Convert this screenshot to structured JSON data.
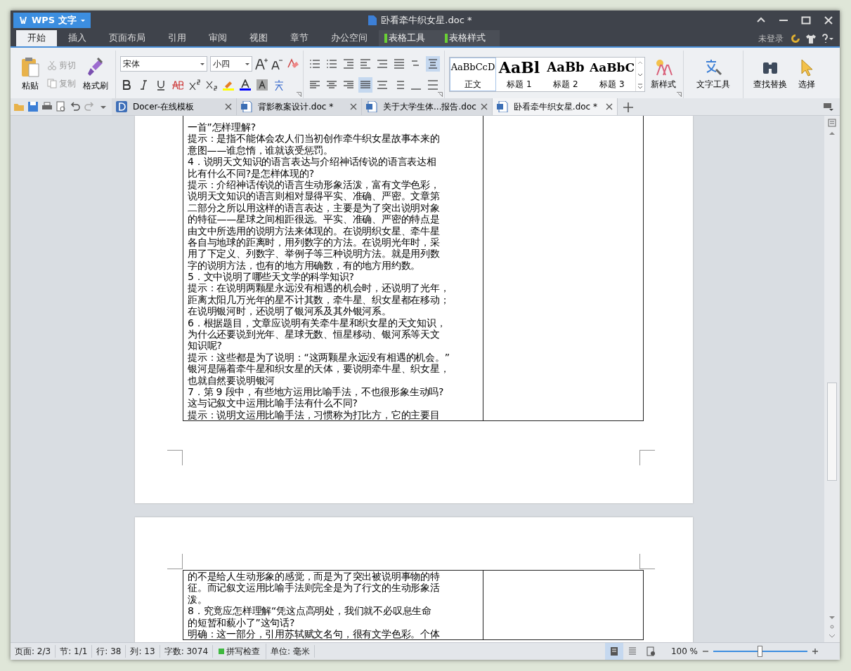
{
  "app_menu": {
    "label": "WPS 文字"
  },
  "window": {
    "title": "卧看牵牛织女星.doc *"
  },
  "ribbon_tabs": [
    {
      "label": "开始",
      "selected": true,
      "kind": "main"
    },
    {
      "label": "插入",
      "selected": false,
      "kind": "main"
    },
    {
      "label": "页面布局",
      "selected": false,
      "kind": "main"
    },
    {
      "label": "引用",
      "selected": false,
      "kind": "main"
    },
    {
      "label": "审阅",
      "selected": false,
      "kind": "main"
    },
    {
      "label": "视图",
      "selected": false,
      "kind": "main"
    },
    {
      "label": "章节",
      "selected": false,
      "kind": "main"
    },
    {
      "label": "办公空间",
      "selected": false,
      "kind": "main"
    },
    {
      "label": "表格工具",
      "selected": false,
      "kind": "context"
    },
    {
      "label": "表格样式",
      "selected": false,
      "kind": "context"
    }
  ],
  "account": {
    "label": "未登录"
  },
  "clipboard": {
    "paste": "粘贴",
    "cut": "剪切",
    "copy": "复制",
    "painter": "格式刷"
  },
  "font": {
    "name": "宋体",
    "size": "小四"
  },
  "styles": [
    {
      "sample": "AaBbCcD",
      "label": "正文",
      "selected": true
    },
    {
      "sample": "AaBl",
      "label": "标题 1",
      "selected": false
    },
    {
      "sample": "AaBb",
      "label": "标题 2",
      "selected": false
    },
    {
      "sample": "AaBbC",
      "label": "标题 3",
      "selected": false
    }
  ],
  "ribbon_buttons": [
    "新样式",
    "文字工具",
    "查找替换",
    "选择"
  ],
  "doc_tabs": [
    {
      "label": "Docer-在线模板",
      "selected": false,
      "kind": "docer"
    },
    {
      "label": "背影教案设计.doc *",
      "selected": false,
      "kind": "doc"
    },
    {
      "label": "关于大学生体...报告.doc",
      "selected": false,
      "kind": "doc"
    },
    {
      "label": "卧看牵牛织女星.doc *",
      "selected": true,
      "kind": "doc"
    }
  ],
  "pages": [
    {
      "lines": [
        "一首”怎样理解?",
        "提示：是指不能体会农人们当初创作牵牛织女星故事本来的",
        "意图——谁怠惰，谁就该受惩罚。",
        "4．说明天文知识的语言表达与介绍神话传说的语言表达相",
        "比有什么不同?是怎样体现的?",
        "提示：介绍神话传说的语言生动形象活泼，富有文学色彩，",
        "说明天文知识的语言则相对显得平实、准确、严密。文章第",
        "二部分之所以用这样的语言表达，主要是为了突出说明对象",
        "的特征——星球之间相距很远。平实、准确、严密的特点是",
        "由文中所选用的说明方法来体现的。在说明织女星、牵牛星",
        "各自与地球的距离时，用列数字的方法。在说明光年时，采",
        "用了下定义、列数字、举例子等三种说明方法。就是用列数",
        "字的说明方法，也有的地方用确数，有的地方用约数。",
        "5．文中说明了哪些天文学的科学知识?",
        "提示：在说明两颗星永远没有相遇的机会时，还说明了光年，",
        "距离太阳几万光年的星不计其数，牵牛星、织女星都在移动；",
        "在说明银河时，还说明了银河系及其外银河系。",
        "6．根据题目，文章应说明有关牵牛星和织女星的天文知识，",
        "为什么还要说到光年、星球无数、恒星移动、银河系等天文",
        "知识呢?",
        "提示：这些都是为了说明：“这两颗星永远没有相遇的机会。”",
        "银河是隔着牵牛星和织女星的天体，要说明牵牛星、织女星，",
        "也就自然要说明银河",
        "7．第 9 段中，有些地方运用比喻手法，不也很形象生动吗?",
        "这与记叙文中运用比喻手法有什么不同?",
        "提示：说明文运用比喻手法，习惯称为打比方，它的主要目"
      ]
    },
    {
      "lines": [
        "的不是给人生动形象的感觉，而是为了突出被说明事物的特",
        "征。而记叙文运用比喻手法则完全是为了行文的生动形象活",
        "泼。",
        "8．究竟应怎样理解“凭这点高明处，我们就不必叹息生命",
        "的短暂和藐小了”这句话?",
        "明确：这一部分，引用苏轼赋文名句，很有文学色彩。个体"
      ]
    }
  ],
  "status_bar": [
    {
      "label": "页面: 2/3",
      "kind": "text"
    },
    {
      "label": "节: 1/1",
      "kind": "text"
    },
    {
      "label": "行: 38",
      "kind": "text"
    },
    {
      "label": "列: 13",
      "kind": "text"
    },
    {
      "label": "字数: 3074",
      "kind": "text"
    },
    {
      "label": "拼写检查",
      "kind": "spell"
    },
    {
      "label": "单位: 毫米",
      "kind": "text"
    }
  ],
  "views": [
    {
      "selected": true
    },
    {
      "selected": false
    },
    {
      "selected": false
    }
  ],
  "zoom": {
    "label": "100 %",
    "level": 0.5
  }
}
